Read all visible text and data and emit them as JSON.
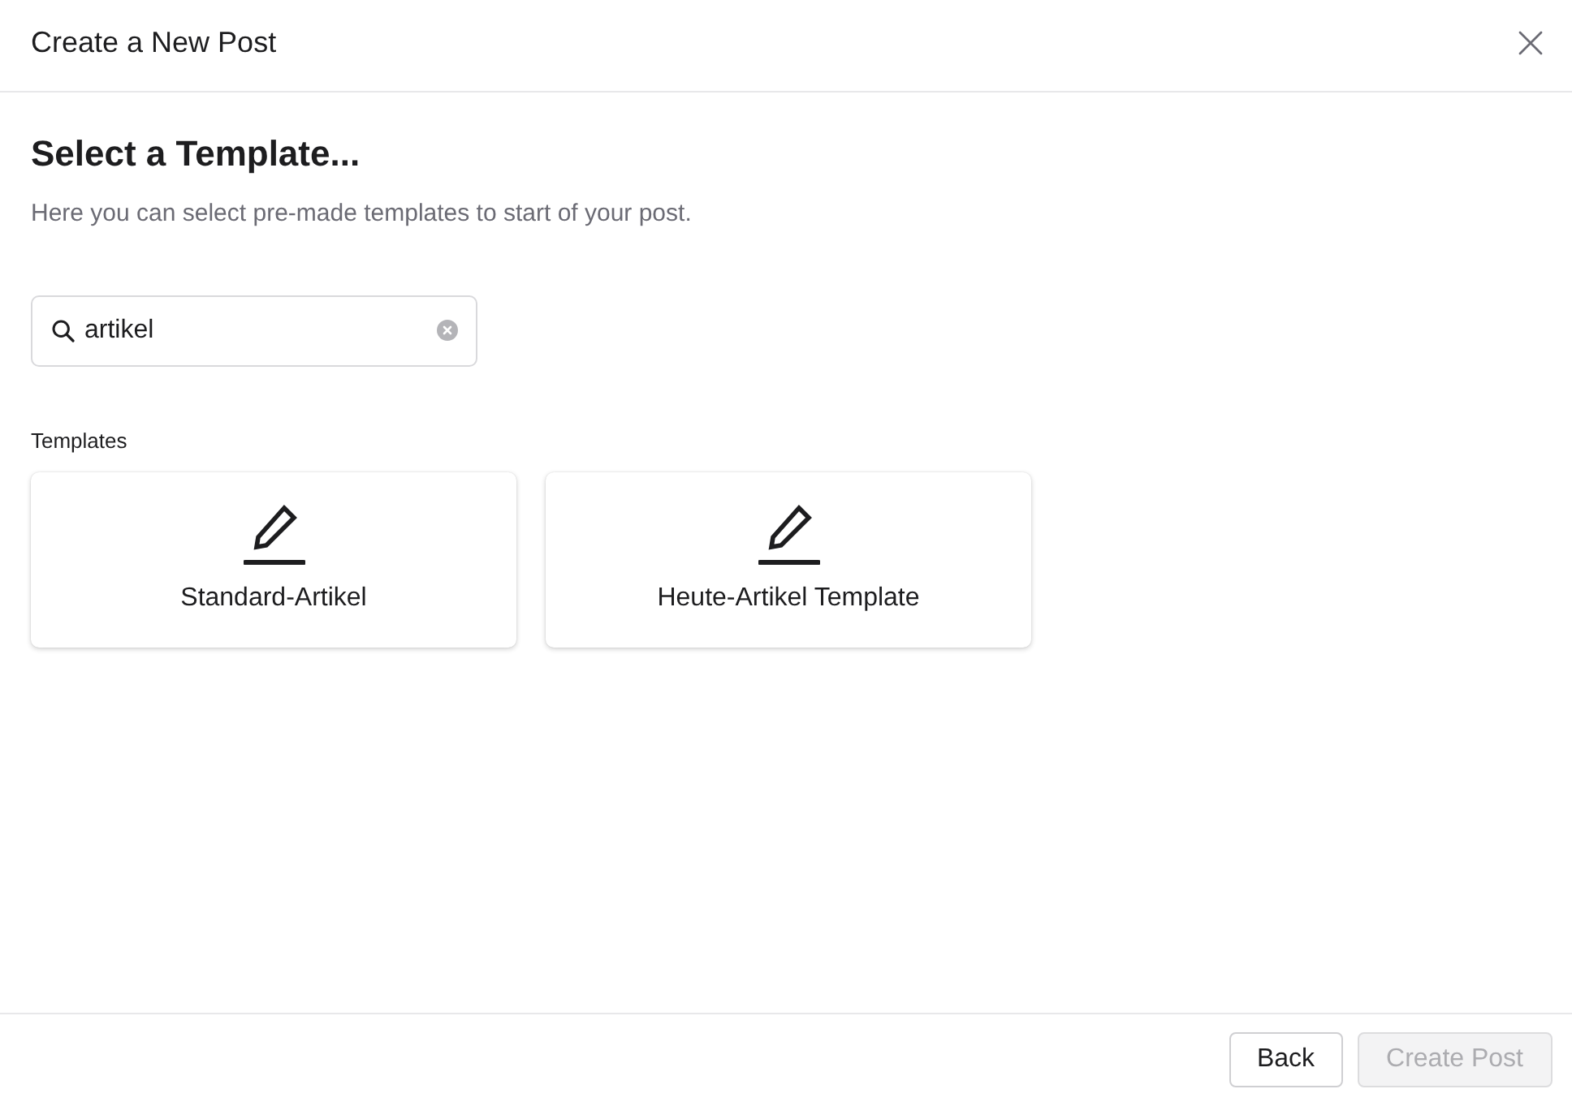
{
  "dialog": {
    "title": "Create a New Post"
  },
  "heading": "Select a Template...",
  "description": "Here you can select pre-made templates to start of your post.",
  "search": {
    "value": "artikel"
  },
  "templates_label": "Templates",
  "templates": [
    {
      "name": "Standard-Artikel"
    },
    {
      "name": "Heute-Artikel Template"
    }
  ],
  "buttons": [
    {
      "label": "Back",
      "disabled": false
    },
    {
      "label": "Create Post",
      "disabled": true
    }
  ]
}
